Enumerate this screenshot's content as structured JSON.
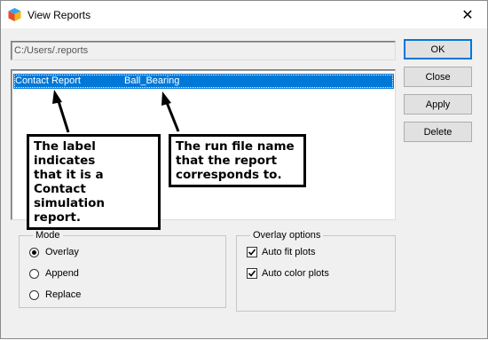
{
  "window": {
    "title": "View Reports",
    "icon": "app-cube-icon",
    "close_glyph": "✕"
  },
  "path_field": {
    "value": "C:/Users/.reports"
  },
  "report_list": {
    "rows": [
      {
        "label": "Contact Report",
        "run_file": "Ball_Bearing",
        "selected": true
      }
    ]
  },
  "callouts": {
    "label": "The label indicates\nthat it is a Contact\nsimulation report.",
    "run_file": "The run file name\nthat the report\ncorresponds to."
  },
  "buttons": {
    "ok": "OK",
    "close": "Close",
    "apply": "Apply",
    "delete": "Delete"
  },
  "mode": {
    "title": "Mode",
    "options": [
      {
        "label": "Overlay",
        "selected": true
      },
      {
        "label": "Append",
        "selected": false
      },
      {
        "label": "Replace",
        "selected": false
      }
    ]
  },
  "overlay_options": {
    "title": "Overlay options",
    "options": [
      {
        "label": "Auto fit plots",
        "checked": true
      },
      {
        "label": "Auto color plots",
        "checked": true
      }
    ]
  },
  "colors": {
    "selection": "#0078d7",
    "dialog_bg": "#f0f0f0"
  }
}
